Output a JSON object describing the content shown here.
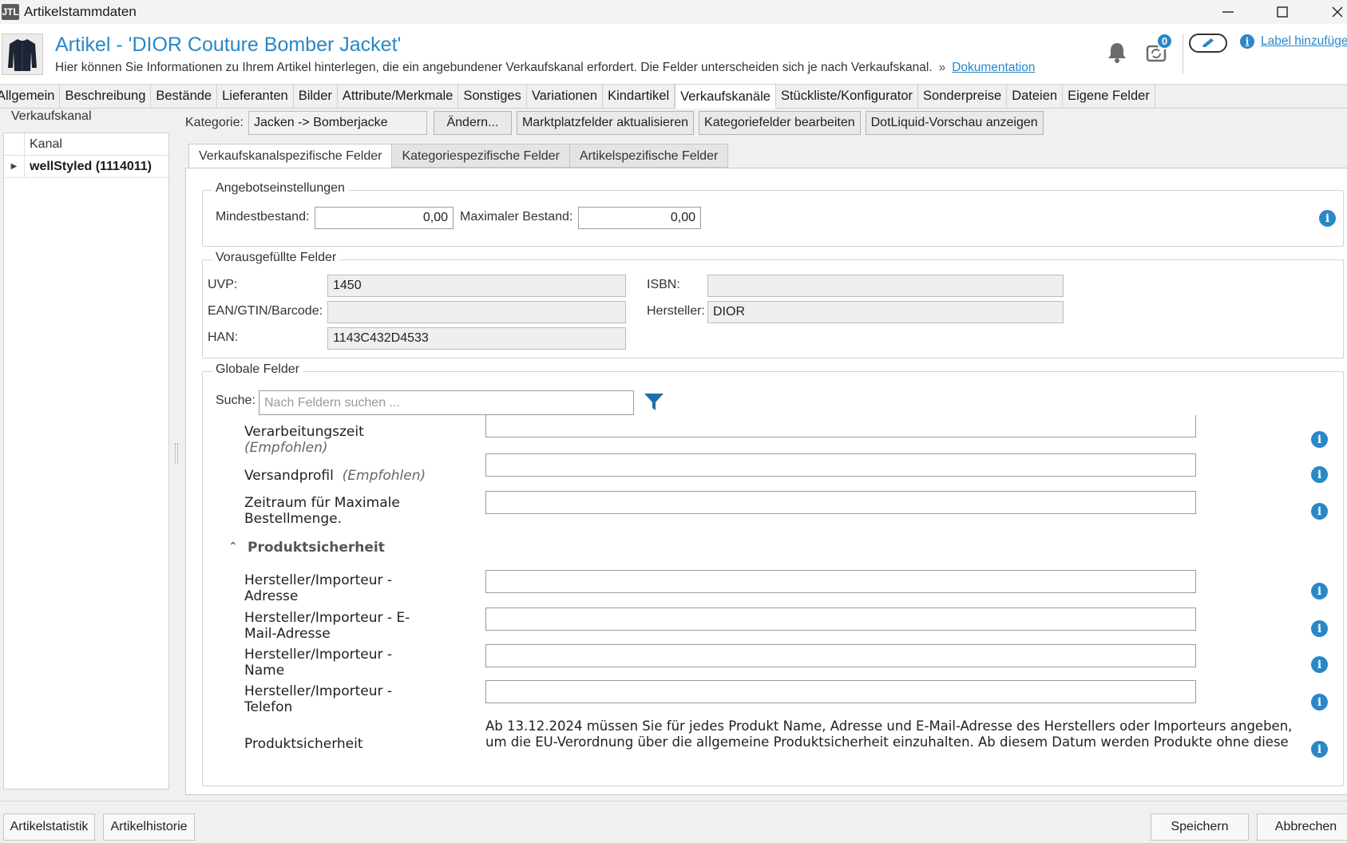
{
  "window": {
    "app_icon_text": "JTL",
    "title": "Artikelstammdaten"
  },
  "header": {
    "title": "Artikel - 'DIOR Couture Bomber Jacket'",
    "subtitle": "Hier können Sie Informationen zu Ihrem Artikel hinterlegen, die ein angebundener Verkaufskanal erfordert. Die Felder unterscheiden sich je nach Verkaufskanal.",
    "separator": "»",
    "doc_link": "Dokumentation",
    "sync_badge": "0",
    "label_add": "Label hinzufügen",
    "colors": {
      "accent": "#2a87c8"
    }
  },
  "tabs": [
    "Allgemein",
    "Beschreibung",
    "Bestände",
    "Lieferanten",
    "Bilder",
    "Attribute/Merkmale",
    "Sonstiges",
    "Variationen",
    "Kindartikel",
    "Verkaufskanäle",
    "Stückliste/Konfigurator",
    "Sonderpreise",
    "Dateien",
    "Eigene Felder"
  ],
  "active_tab": "Verkaufskanäle",
  "left": {
    "legend": "Verkaufskanal",
    "column": "Kanal",
    "rows": [
      {
        "label": "wellStyled (1114011)"
      }
    ]
  },
  "kategorie": {
    "label": "Kategorie:",
    "value": "Jacken -> Bomberjacke",
    "buttons": [
      "Ändern...",
      "Marktplatzfelder aktualisieren",
      "Kategoriefelder bearbeiten",
      "DotLiquid-Vorschau anzeigen"
    ]
  },
  "subtabs": [
    "Verkaufskanalspezifische Felder",
    "Kategoriespezifische Felder",
    "Artikelspezifische Felder"
  ],
  "angebot": {
    "legend": "Angebotseinstellungen",
    "min_label": "Mindestbestand:",
    "min_value": "0,00",
    "max_label": "Maximaler Bestand:",
    "max_value": "0,00"
  },
  "vorausgefuellt": {
    "legend": "Vorausgefüllte Felder",
    "uvp_label": "UVP:",
    "uvp_value": "1450",
    "ean_label": "EAN/GTIN/Barcode:",
    "ean_value": "",
    "han_label": "HAN:",
    "han_value": "1143C432D4533",
    "isbn_label": "ISBN:",
    "isbn_value": "",
    "hersteller_label": "Hersteller:",
    "hersteller_value": "DIOR"
  },
  "global": {
    "legend": "Globale Felder",
    "search_label": "Suche:",
    "search_placeholder": "Nach Feldern suchen ...",
    "fields": [
      {
        "line1": "Verarbeitungszeit",
        "line2_em": "(Empfohlen)"
      },
      {
        "line1": "Versandprofil",
        "inline_em": "(Empfohlen)"
      },
      {
        "line1": "Zeitraum für Maximale",
        "line2": "Bestellmenge."
      }
    ],
    "section": "Produktsicherheit",
    "section_fields": [
      {
        "line1": "Hersteller/Importeur -",
        "line2": "Adresse"
      },
      {
        "line1": "Hersteller/Importeur - E-",
        "line2": "Mail-Adresse"
      },
      {
        "line1": "Hersteller/Importeur -",
        "line2": "Name"
      },
      {
        "line1": "Hersteller/Importeur -",
        "line2": "Telefon"
      }
    ],
    "note_label": "Produktsicherheit",
    "note_line1": "Ab 13.12.2024 müssen Sie für jedes Produkt Name, Adresse und E-Mail-Adresse des Herstellers oder Importeurs angeben,",
    "note_line2": "um die EU-Verordnung über die allgemeine Produktsicherheit einzuhalten. Ab diesem Datum werden Produkte ohne diese"
  },
  "footer": {
    "artikelstatistik": "Artikelstatistik",
    "artikelhistorie": "Artikelhistorie",
    "speichern": "Speichern",
    "abbrechen": "Abbrechen"
  }
}
